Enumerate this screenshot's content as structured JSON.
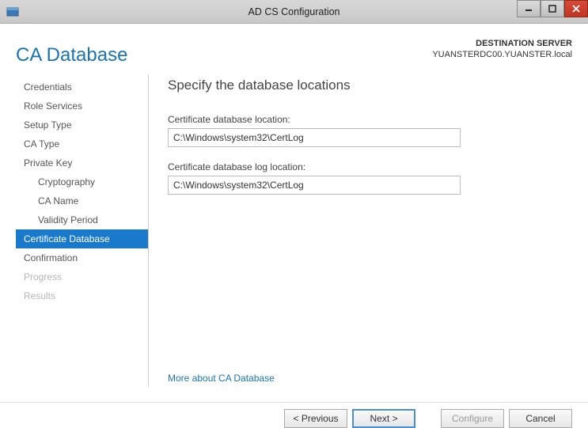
{
  "window": {
    "title": "AD CS Configuration"
  },
  "header": {
    "page_title": "CA Database",
    "destination_label": "DESTINATION SERVER",
    "destination_value": "YUANSTERDC00.YUANSTER.local"
  },
  "sidebar": {
    "items": [
      {
        "label": "Credentials",
        "sub": false,
        "selected": false,
        "disabled": false
      },
      {
        "label": "Role Services",
        "sub": false,
        "selected": false,
        "disabled": false
      },
      {
        "label": "Setup Type",
        "sub": false,
        "selected": false,
        "disabled": false
      },
      {
        "label": "CA Type",
        "sub": false,
        "selected": false,
        "disabled": false
      },
      {
        "label": "Private Key",
        "sub": false,
        "selected": false,
        "disabled": false
      },
      {
        "label": "Cryptography",
        "sub": true,
        "selected": false,
        "disabled": false
      },
      {
        "label": "CA Name",
        "sub": true,
        "selected": false,
        "disabled": false
      },
      {
        "label": "Validity Period",
        "sub": true,
        "selected": false,
        "disabled": false
      },
      {
        "label": "Certificate Database",
        "sub": false,
        "selected": true,
        "disabled": false
      },
      {
        "label": "Confirmation",
        "sub": false,
        "selected": false,
        "disabled": false
      },
      {
        "label": "Progress",
        "sub": false,
        "selected": false,
        "disabled": true
      },
      {
        "label": "Results",
        "sub": false,
        "selected": false,
        "disabled": true
      }
    ]
  },
  "main": {
    "heading": "Specify the database locations",
    "db_loc_label": "Certificate database location:",
    "db_loc_value": "C:\\Windows\\system32\\CertLog",
    "log_loc_label": "Certificate database log location:",
    "log_loc_value": "C:\\Windows\\system32\\CertLog",
    "help_link": "More about CA Database"
  },
  "footer": {
    "previous": "< Previous",
    "next": "Next >",
    "configure": "Configure",
    "cancel": "Cancel"
  }
}
